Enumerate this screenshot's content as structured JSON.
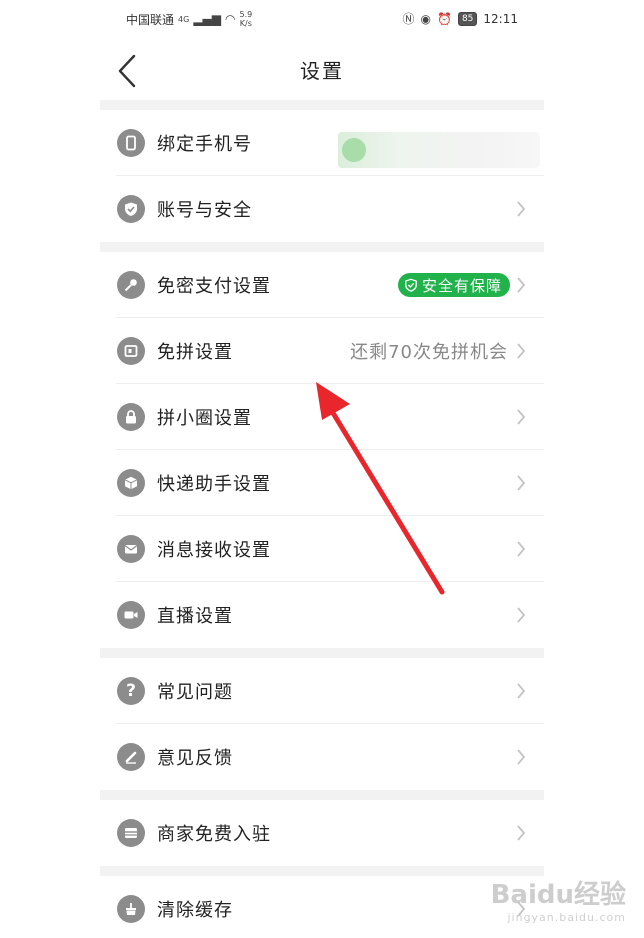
{
  "status_bar": {
    "carrier": "中国联通",
    "network": "4G",
    "speed_value": "5.9",
    "speed_unit": "K/s",
    "battery": "85",
    "time": "12:11"
  },
  "header": {
    "title": "设置"
  },
  "groups": [
    {
      "items": [
        {
          "label": "绑定手机号",
          "icon": "phone-icon",
          "value": ""
        },
        {
          "label": "账号与安全",
          "icon": "shield-icon",
          "value": ""
        }
      ]
    },
    {
      "items": [
        {
          "label": "免密支付设置",
          "icon": "key-icon",
          "badge": "安全有保障"
        },
        {
          "label": "免拼设置",
          "icon": "ticket-icon",
          "value": "还剩70次免拼机会"
        },
        {
          "label": "拼小圈设置",
          "icon": "lock-icon",
          "value": ""
        },
        {
          "label": "快递助手设置",
          "icon": "package-icon",
          "value": ""
        },
        {
          "label": "消息接收设置",
          "icon": "mail-icon",
          "value": ""
        },
        {
          "label": "直播设置",
          "icon": "camera-icon",
          "value": ""
        }
      ]
    },
    {
      "items": [
        {
          "label": "常见问题",
          "icon": "question-icon",
          "value": ""
        },
        {
          "label": "意见反馈",
          "icon": "pencil-icon",
          "value": ""
        }
      ]
    },
    {
      "items": [
        {
          "label": "商家免费入驻",
          "icon": "store-icon",
          "value": ""
        }
      ]
    },
    {
      "items": [
        {
          "label": "清除缓存",
          "icon": "broom-icon",
          "value": ""
        }
      ]
    }
  ],
  "colors": {
    "badge_green": "#22b24c",
    "annotation_red": "#e8262c",
    "icon_gray": "#8c8c8c"
  },
  "watermark": {
    "brand": "Baidu经验",
    "url": "jingyan.baidu.com"
  }
}
